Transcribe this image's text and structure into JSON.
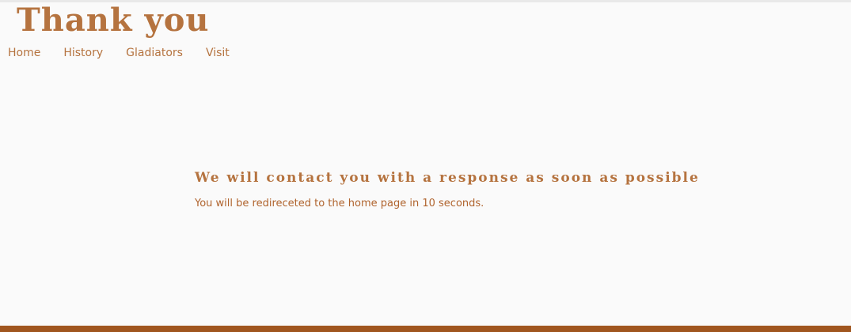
{
  "header": {
    "title": "Thank you"
  },
  "nav": {
    "items": [
      {
        "label": "Home"
      },
      {
        "label": "History"
      },
      {
        "label": "Gladiators"
      },
      {
        "label": "Visit"
      }
    ]
  },
  "main": {
    "heading": "We will contact you with a response as soon as possible",
    "redirect_text": "You will be redireceted to the home page in 10 seconds."
  },
  "colors": {
    "accent": "#b5733f",
    "footer_bar": "#a0561f",
    "background": "#fafafa"
  }
}
